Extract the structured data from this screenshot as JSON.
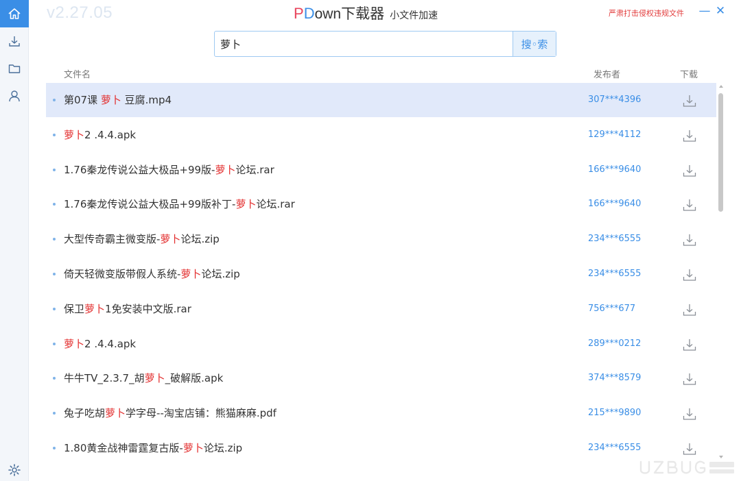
{
  "app": {
    "version": "v2.27.05",
    "title_p": "P",
    "title_d": "D",
    "title_rest": "own下载器",
    "subtitle": "小文件加速",
    "warning_link": "严肃打击侵权违规文件",
    "minimize_glyph": "—",
    "close_glyph": "✕"
  },
  "sidebar": {
    "items": [
      {
        "icon": "home-icon",
        "active": true
      },
      {
        "icon": "download-icon",
        "active": false
      },
      {
        "icon": "folder-icon",
        "active": false
      },
      {
        "icon": "user-icon",
        "active": false
      }
    ],
    "settings_icon": "gear-icon"
  },
  "search": {
    "value": "萝卜",
    "button_label": "搜◦索"
  },
  "columns": {
    "filename": "文件名",
    "publisher": "发布者",
    "download": "下载"
  },
  "results": [
    {
      "pre": "第07课 ",
      "hl": "萝卜",
      "post": " 豆腐.mp4",
      "publisher": "307***4396",
      "selected": true
    },
    {
      "pre": "",
      "hl": "萝卜",
      "post": "2 .4.4.apk",
      "publisher": "129***4112",
      "selected": false
    },
    {
      "pre": "1.76秦龙传说公益大极品+99版-",
      "hl": "萝卜",
      "post": "论坛.rar",
      "publisher": "166***9640",
      "selected": false
    },
    {
      "pre": "1.76秦龙传说公益大极品+99版补丁-",
      "hl": "萝卜",
      "post": "论坛.rar",
      "publisher": "166***9640",
      "selected": false
    },
    {
      "pre": "大型传奇霸主微变版-",
      "hl": "萝卜",
      "post": "论坛.zip",
      "publisher": "234***6555",
      "selected": false
    },
    {
      "pre": "倚天轻微变版带假人系统-",
      "hl": "萝卜",
      "post": "论坛.zip",
      "publisher": "234***6555",
      "selected": false
    },
    {
      "pre": "保卫",
      "hl": "萝卜",
      "post": "1免安装中文版.rar",
      "publisher": "756***677",
      "selected": false
    },
    {
      "pre": "",
      "hl": "萝卜",
      "post": "2 .4.4.apk",
      "publisher": "289***0212",
      "selected": false
    },
    {
      "pre": "牛牛TV_2.3.7_胡",
      "hl": "萝卜",
      "post": "_破解版.apk",
      "publisher": "374***8579",
      "selected": false
    },
    {
      "pre": "兔子吃胡",
      "hl": "萝卜",
      "post": "学字母--淘宝店铺：熊猫麻麻.pdf",
      "publisher": "215***9890",
      "selected": false
    },
    {
      "pre": "1.80黄金战神雷霆复古版-",
      "hl": "萝卜",
      "post": "论坛.zip",
      "publisher": "234***6555",
      "selected": false
    }
  ],
  "colors": {
    "accent": "#3a8ee6",
    "highlight": "#e32f2f",
    "title_p": "#e8435b",
    "selected_row": "#e1e9fa"
  }
}
